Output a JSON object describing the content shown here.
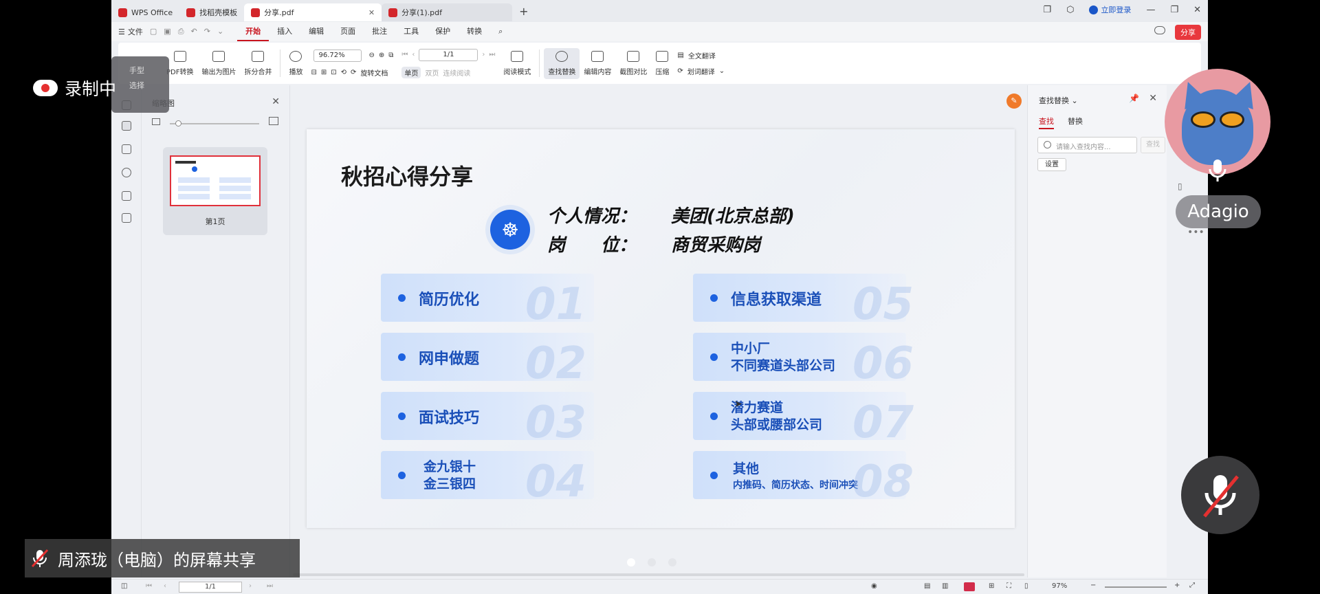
{
  "tabs": [
    {
      "label": "WPS Office",
      "color": "#d3262b",
      "active": false
    },
    {
      "label": "找稻壳模板",
      "color": "#d3262b",
      "active": false
    },
    {
      "label": "分享.pdf",
      "color": "#d3262b",
      "active": true
    },
    {
      "label": "分享(1).pdf",
      "color": "#d3262b",
      "active": false
    }
  ],
  "titlebar": {
    "login": "立即登录",
    "new_tab": "+"
  },
  "menubar": {
    "file": "文件",
    "items": [
      "开始",
      "插入",
      "编辑",
      "页面",
      "批注",
      "工具",
      "保护",
      "转换"
    ],
    "active": "开始",
    "share": "分享"
  },
  "ribbon": {
    "hand": "手型",
    "select": "选择",
    "pdf_convert": "PDF转换",
    "export_img": "输出为图片",
    "split_merge": "拆分合并",
    "play": "播放",
    "zoom": "96.72%",
    "page": "1/1",
    "rotate": "旋转文档",
    "single": "单页",
    "double": "双页",
    "continuous": "连续阅读",
    "read_mode": "阅读模式",
    "find_replace": "查找替换",
    "edit_content": "编辑内容",
    "compare": "截图对比",
    "compress": "压缩",
    "full_translate": "全文翻译",
    "word_translate": "划词翻译"
  },
  "thumbs": {
    "title": "缩略图",
    "page_label": "第1页"
  },
  "slide": {
    "title": "秋招心得分享",
    "personal_label": "个人情况：",
    "personal_value": "美团(北京总部)",
    "position_label": "岗　　位：",
    "position_value": "商贸采购岗",
    "cards_left": [
      {
        "line1": "简历优化",
        "line2": "",
        "num": "01"
      },
      {
        "line1": "网申做题",
        "line2": "",
        "num": "02"
      },
      {
        "line1": "面试技巧",
        "line2": "",
        "num": "03"
      },
      {
        "line1": "金九银十",
        "line2": "金三银四",
        "num": "04"
      }
    ],
    "cards_right": [
      {
        "line1": "信息获取渠道",
        "line2": "",
        "num": "05"
      },
      {
        "line1": "中小厂",
        "line2": "不同赛道头部公司",
        "num": "06"
      },
      {
        "line1": "潜力赛道",
        "line2": "头部或腰部公司",
        "num": "07"
      },
      {
        "line1": "其他",
        "line2": "内推码、简历状态、时间冲突",
        "num": "08"
      }
    ]
  },
  "find": {
    "title": "查找替换",
    "tab_find": "查找",
    "tab_replace": "替换",
    "placeholder": "请输入查找内容...",
    "find_btn": "查找",
    "settings": "设置"
  },
  "status": {
    "page": "1/1",
    "zoom": "97%"
  },
  "overlay": {
    "recording": "录制中",
    "sharer": "周添珑（电脑）的屏幕共享",
    "participant": "Adagio"
  }
}
